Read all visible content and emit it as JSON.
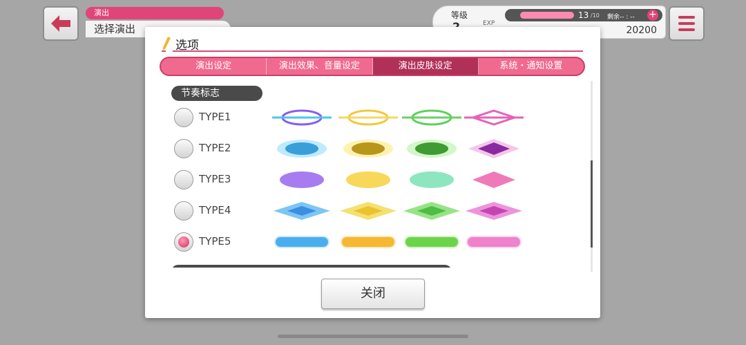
{
  "header": {
    "crumb_top": "演出",
    "crumb_main": "选择演出",
    "level_label": "等级",
    "level_value": "2",
    "exp_label": "EXP",
    "live_points": "13",
    "live_points_max": "/10",
    "timer": "剩余-- : --",
    "coins": "20200"
  },
  "modal": {
    "title": "选项",
    "tabs": [
      {
        "label": "演出设定",
        "active": false
      },
      {
        "label": "演出效果、音量设定",
        "active": false
      },
      {
        "label": "演出皮肤设定",
        "active": true
      },
      {
        "label": "系统・通知设置",
        "active": false
      }
    ],
    "section_label": "节奏标志",
    "types": [
      {
        "label": "TYPE1",
        "selected": false,
        "style": "line-ring"
      },
      {
        "label": "TYPE2",
        "selected": false,
        "style": "glow-disc"
      },
      {
        "label": "TYPE3",
        "selected": false,
        "style": "flat-disc"
      },
      {
        "label": "TYPE4",
        "selected": false,
        "style": "diamond"
      },
      {
        "label": "TYPE5",
        "selected": true,
        "style": "pill"
      }
    ],
    "note_colors": [
      "#5b9cf0",
      "#f2c83a",
      "#5fd05a",
      "#e463b8"
    ],
    "close_label": "关闭"
  },
  "colors": {
    "accent": "#e0457a",
    "tab_active": "#b03058"
  }
}
